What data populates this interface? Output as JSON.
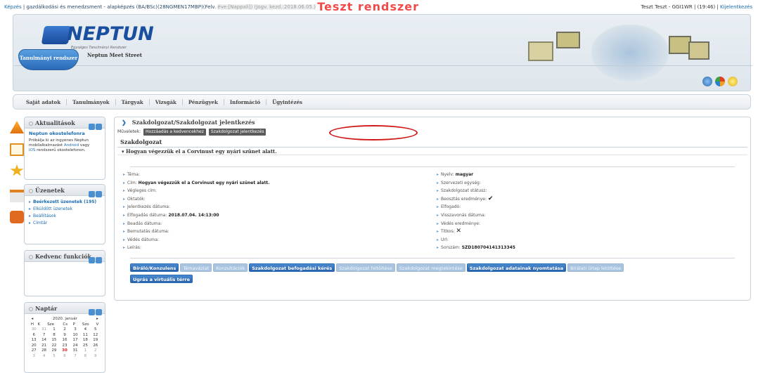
{
  "topbar": {
    "kepzes_label": "Képzés",
    "kepzes_text": "| gazdálkodási és menedzsment - alapképzés (BA/BSc)(28NGMEN17MBP)(Felv.",
    "dim_text": "éve:[Nappali]) (Jogv. kezd.:2018.06.05.)",
    "teszt": "Teszt rendszer",
    "user": "Teszt Teszt - GGI1WR",
    "time": "| (19:46) |",
    "logout": "Kijelentkezés"
  },
  "header": {
    "logo_name": "NEPTUN",
    "logo_sub": "Egységes Tanulmányi Rendszer",
    "tab_active": "Tanulmányi rendszer",
    "tab_other": "Neptun Meet Street"
  },
  "mainnav": [
    "Saját adatok",
    "Tanulmányok",
    "Tárgyak",
    "Vizsgák",
    "Pénzügyek",
    "Információ",
    "Ügyintézés"
  ],
  "widgets": {
    "news": {
      "title": "Aktualitások",
      "item_title": "Neptun okostelefonra",
      "text1": "Próbálja ki az ingyenes Neptun",
      "text2_pre": "mobilalkalmazást ",
      "android": "Android",
      "text2_post": " vagy",
      "ios": "iOS",
      "text3": " rendszerű okostelefonon."
    },
    "messages": {
      "title": "Üzenetek",
      "items": [
        "Beérkezett üzenetek (195)",
        "Elküldött üzenetek",
        "Beállítások",
        "Címtár"
      ]
    },
    "favorites": {
      "title": "Kedvenc funkciók"
    },
    "calendar": {
      "title": "Naptár",
      "month": "2020. január",
      "prev": "◂",
      "next": "▸",
      "days": [
        "H",
        "K",
        "Sze",
        "Cs",
        "P",
        "Szo",
        "V"
      ],
      "weeks": [
        [
          "30",
          "31",
          "1",
          "2",
          "3",
          "4",
          "5"
        ],
        [
          "6",
          "7",
          "8",
          "9",
          "10",
          "11",
          "12"
        ],
        [
          "13",
          "14",
          "15",
          "16",
          "17",
          "18",
          "19"
        ],
        [
          "20",
          "21",
          "22",
          "23",
          "24",
          "25",
          "26"
        ],
        [
          "27",
          "28",
          "29",
          "30",
          "31",
          "1",
          "2"
        ],
        [
          "3",
          "4",
          "5",
          "6",
          "7",
          "8",
          "9"
        ]
      ],
      "today": "30"
    }
  },
  "content": {
    "breadcrumb": "Szakdolgozat/Szakdolgozat jelentkezés",
    "ops_label": "Műveletek:",
    "ops_add_fav": "Hozzáadás a kedvencekhez",
    "ops_apply": "Szakdolgozat jelentkezés",
    "section": "Szakdolgozat",
    "thesis_title": "Hogyan végezzük el a Corvinust egy nyári szünet alatt.",
    "left_fields": [
      {
        "label": "Téma:",
        "value": ""
      },
      {
        "label": "Cím:",
        "value": "Hogyan végezzük el a Corvinust egy nyári szünet alatt."
      },
      {
        "label": "Végleges cím:",
        "value": ""
      },
      {
        "label": "Oktatók:",
        "value": ""
      },
      {
        "label": "Jelentkezés dátuma:",
        "value": ""
      },
      {
        "label": "Elfogadás dátuma:",
        "value": "2018.07.04. 14:13:00"
      },
      {
        "label": "Beadás dátuma:",
        "value": ""
      },
      {
        "label": "Bemutatás dátuma:",
        "value": ""
      },
      {
        "label": "Védés dátuma:",
        "value": ""
      },
      {
        "label": "Leírás:",
        "value": ""
      }
    ],
    "right_fields": [
      {
        "label": "Nyelv:",
        "value": "magyar"
      },
      {
        "label": "Szervezeti egység:",
        "value": ""
      },
      {
        "label": "Szakdolgozat státusz:",
        "value": ""
      },
      {
        "label": "Beosztás eredménye:",
        "value": "✔"
      },
      {
        "label": "Elfogadó:",
        "value": ""
      },
      {
        "label": "Visszavonás dátuma:",
        "value": ""
      },
      {
        "label": "Védés eredménye:",
        "value": ""
      },
      {
        "label": "Titkos:",
        "value": "✕"
      },
      {
        "label": "Url:",
        "value": ""
      },
      {
        "label": "Sorszám:",
        "value": "SZD180704141313345"
      }
    ],
    "buttons_row1": [
      {
        "label": "Bíráló/Konzulens",
        "enabled": true
      },
      {
        "label": "Témavázlat",
        "enabled": false
      },
      {
        "label": "Konzultációk",
        "enabled": false
      },
      {
        "label": "Szakdolgozat befogadási kérés",
        "enabled": true
      },
      {
        "label": "Szakdolgozat feltöltése",
        "enabled": false
      },
      {
        "label": "Szakdolgozat megtekintése",
        "enabled": false
      },
      {
        "label": "Szakdolgozat adatainak nyomtatása",
        "enabled": true
      },
      {
        "label": "Bírálati űrlap letöltése",
        "enabled": false
      }
    ],
    "buttons_row2": [
      {
        "label": "Ugrás a virtuális térre",
        "enabled": true
      }
    ]
  }
}
